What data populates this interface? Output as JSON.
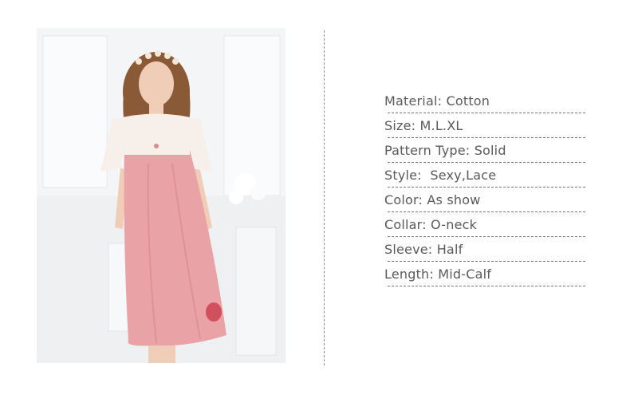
{
  "colors": {
    "dress": "#e9a3a6",
    "lace": "#f7efe9",
    "hair": "#8a5a36",
    "skin": "#f0cdb6",
    "text": "#5a5a5a",
    "divider": "#8f8f8f"
  },
  "specs": [
    {
      "label": "Material:",
      "value": "Cotton"
    },
    {
      "label": "Size:",
      "value": "M.L.XL"
    },
    {
      "label": "Pattern Type:",
      "value": "Solid"
    },
    {
      "label": "Style:",
      "value": " Sexy,Lace"
    },
    {
      "label": "Color:",
      "value": "As show"
    },
    {
      "label": "Collar:",
      "value": "O-neck"
    },
    {
      "label": "Sleeve:",
      "value": "Half"
    },
    {
      "label": "Length:",
      "value": "Mid-Calf"
    }
  ]
}
